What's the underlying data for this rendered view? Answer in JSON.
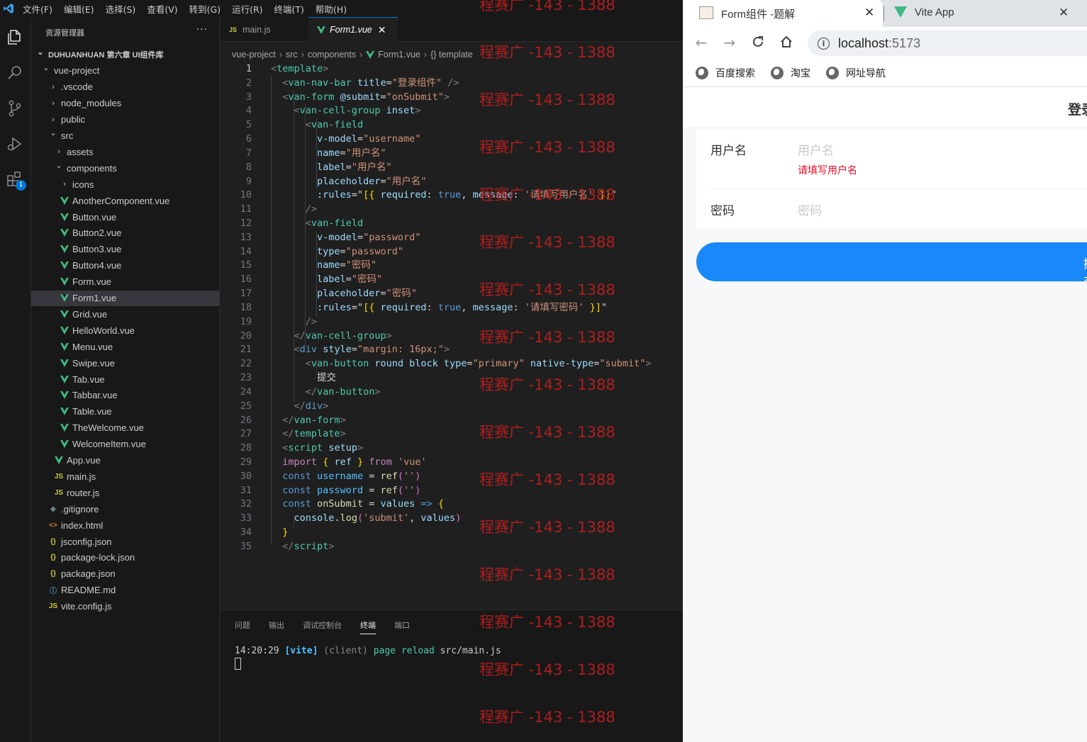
{
  "vscode": {
    "menu": [
      "文件(F)",
      "编辑(E)",
      "选择(S)",
      "查看(V)",
      "转到(G)",
      "运行(R)",
      "终端(T)",
      "帮助(H)"
    ],
    "explorer_title": "资源管理器",
    "explorer_more": "···",
    "extensions_badge": "1",
    "tree": [
      {
        "label": "DUHUANHUAN 第六章 UI组件库",
        "depth": 0,
        "chev": "⌄",
        "icon": "",
        "bold": true
      },
      {
        "label": "vue-project",
        "depth": 1,
        "chev": "⌄",
        "icon": ""
      },
      {
        "label": ".vscode",
        "depth": 2,
        "chev": "›",
        "icon": ""
      },
      {
        "label": "node_modules",
        "depth": 2,
        "chev": "›",
        "icon": ""
      },
      {
        "label": "public",
        "depth": 2,
        "chev": "›",
        "icon": ""
      },
      {
        "label": "src",
        "depth": 2,
        "chev": "⌄",
        "icon": ""
      },
      {
        "label": "assets",
        "depth": 3,
        "chev": "›",
        "icon": ""
      },
      {
        "label": "components",
        "depth": 3,
        "chev": "⌄",
        "icon": ""
      },
      {
        "label": "icons",
        "depth": 4,
        "chev": "›",
        "icon": ""
      },
      {
        "label": "AnotherComponent.vue",
        "depth": 4,
        "chev": "",
        "icon": "vue"
      },
      {
        "label": "Button.vue",
        "depth": 4,
        "chev": "",
        "icon": "vue"
      },
      {
        "label": "Button2.vue",
        "depth": 4,
        "chev": "",
        "icon": "vue"
      },
      {
        "label": "Button3.vue",
        "depth": 4,
        "chev": "",
        "icon": "vue"
      },
      {
        "label": "Button4.vue",
        "depth": 4,
        "chev": "",
        "icon": "vue"
      },
      {
        "label": "Form.vue",
        "depth": 4,
        "chev": "",
        "icon": "vue"
      },
      {
        "label": "Form1.vue",
        "depth": 4,
        "chev": "",
        "icon": "vue",
        "selected": true
      },
      {
        "label": "Grid.vue",
        "depth": 4,
        "chev": "",
        "icon": "vue"
      },
      {
        "label": "HelloWorld.vue",
        "depth": 4,
        "chev": "",
        "icon": "vue"
      },
      {
        "label": "Menu.vue",
        "depth": 4,
        "chev": "",
        "icon": "vue"
      },
      {
        "label": "Swipe.vue",
        "depth": 4,
        "chev": "",
        "icon": "vue"
      },
      {
        "label": "Tab.vue",
        "depth": 4,
        "chev": "",
        "icon": "vue"
      },
      {
        "label": "Tabbar.vue",
        "depth": 4,
        "chev": "",
        "icon": "vue"
      },
      {
        "label": "Table.vue",
        "depth": 4,
        "chev": "",
        "icon": "vue"
      },
      {
        "label": "TheWelcome.vue",
        "depth": 4,
        "chev": "",
        "icon": "vue"
      },
      {
        "label": "WelcomeItem.vue",
        "depth": 4,
        "chev": "",
        "icon": "vue"
      },
      {
        "label": "App.vue",
        "depth": 3,
        "chev": "",
        "icon": "vue"
      },
      {
        "label": "main.js",
        "depth": 3,
        "chev": "",
        "icon": "js"
      },
      {
        "label": "router.js",
        "depth": 3,
        "chev": "",
        "icon": "js"
      },
      {
        "label": ".gitignore",
        "depth": 2,
        "chev": "",
        "icon": "git"
      },
      {
        "label": "index.html",
        "depth": 2,
        "chev": "",
        "icon": "html"
      },
      {
        "label": "jsconfig.json",
        "depth": 2,
        "chev": "",
        "icon": "json"
      },
      {
        "label": "package-lock.json",
        "depth": 2,
        "chev": "",
        "icon": "json"
      },
      {
        "label": "package.json",
        "depth": 2,
        "chev": "",
        "icon": "json"
      },
      {
        "label": "README.md",
        "depth": 2,
        "chev": "",
        "icon": "info"
      },
      {
        "label": "vite.config.js",
        "depth": 2,
        "chev": "",
        "icon": "js"
      }
    ],
    "icon_glyphs": {
      "vue": "",
      "js": "JS",
      "json": "{}",
      "html": "<>",
      "git": "◆",
      "info": "ⓘ"
    },
    "tabs": [
      {
        "label": "main.js",
        "icon": "js",
        "active": false
      },
      {
        "label": "Form1.vue",
        "icon": "vue",
        "active": true,
        "close": "✕"
      }
    ],
    "breadcrumb": [
      "vue-project",
      "src",
      "components",
      "Form1.vue",
      "{} template"
    ],
    "current_line": 1,
    "code": [
      [
        [
          "t-punc",
          "<"
        ],
        [
          "t-tag",
          "template"
        ],
        [
          "t-punc",
          ">"
        ]
      ],
      [
        [
          "",
          "  "
        ],
        [
          "t-punc",
          "<"
        ],
        [
          "t-tag",
          "van-nav-bar"
        ],
        [
          "",
          " "
        ],
        [
          "t-attr",
          "title"
        ],
        [
          "t-txt",
          "="
        ],
        [
          "t-str",
          "\"登录组件\""
        ],
        [
          "",
          " "
        ],
        [
          "t-punc",
          "/>"
        ]
      ],
      [
        [
          "",
          "  "
        ],
        [
          "t-punc",
          "<"
        ],
        [
          "t-tag",
          "van-form"
        ],
        [
          "",
          " "
        ],
        [
          "t-attr",
          "@submit"
        ],
        [
          "t-txt",
          "="
        ],
        [
          "t-str",
          "\"onSubmit\""
        ],
        [
          "t-punc",
          ">"
        ]
      ],
      [
        [
          "",
          "    "
        ],
        [
          "t-punc",
          "<"
        ],
        [
          "t-tag",
          "van-cell-group"
        ],
        [
          "",
          " "
        ],
        [
          "t-attr",
          "inset"
        ],
        [
          "t-punc",
          ">"
        ]
      ],
      [
        [
          "",
          "      "
        ],
        [
          "t-punc",
          "<"
        ],
        [
          "t-tag",
          "van-field"
        ]
      ],
      [
        [
          "",
          "        "
        ],
        [
          "t-attr",
          "v-model"
        ],
        [
          "t-txt",
          "="
        ],
        [
          "t-str",
          "\"username\""
        ]
      ],
      [
        [
          "",
          "        "
        ],
        [
          "t-attr",
          "name"
        ],
        [
          "t-txt",
          "="
        ],
        [
          "t-str",
          "\"用户名\""
        ]
      ],
      [
        [
          "",
          "        "
        ],
        [
          "t-attr",
          "label"
        ],
        [
          "t-txt",
          "="
        ],
        [
          "t-str",
          "\"用户名\""
        ]
      ],
      [
        [
          "",
          "        "
        ],
        [
          "t-attr",
          "placeholder"
        ],
        [
          "t-txt",
          "="
        ],
        [
          "t-str",
          "\"用户名\""
        ]
      ],
      [
        [
          "",
          "        "
        ],
        [
          "t-attr",
          ":rules"
        ],
        [
          "t-txt",
          "=\""
        ],
        [
          "t-brk",
          "[{"
        ],
        [
          "",
          " "
        ],
        [
          "t-attr",
          "required"
        ],
        [
          "t-txt",
          ":"
        ],
        [
          "",
          " "
        ],
        [
          "t-kw",
          "true"
        ],
        [
          "t-txt",
          ","
        ],
        [
          "",
          " "
        ],
        [
          "t-attr",
          "message"
        ],
        [
          "t-txt",
          ":"
        ],
        [
          "",
          " "
        ],
        [
          "t-str",
          "'请填写用户名'"
        ],
        [
          "",
          " "
        ],
        [
          "t-brk",
          "}]"
        ],
        [
          "t-txt",
          "\""
        ]
      ],
      [
        [
          "",
          "      "
        ],
        [
          "t-punc",
          "/>"
        ]
      ],
      [
        [
          "",
          "      "
        ],
        [
          "t-punc",
          "<"
        ],
        [
          "t-tag",
          "van-field"
        ]
      ],
      [
        [
          "",
          "        "
        ],
        [
          "t-attr",
          "v-model"
        ],
        [
          "t-txt",
          "="
        ],
        [
          "t-str",
          "\"password\""
        ]
      ],
      [
        [
          "",
          "        "
        ],
        [
          "t-attr",
          "type"
        ],
        [
          "t-txt",
          "="
        ],
        [
          "t-str",
          "\"password\""
        ]
      ],
      [
        [
          "",
          "        "
        ],
        [
          "t-attr",
          "name"
        ],
        [
          "t-txt",
          "="
        ],
        [
          "t-str",
          "\"密码\""
        ]
      ],
      [
        [
          "",
          "        "
        ],
        [
          "t-attr",
          "label"
        ],
        [
          "t-txt",
          "="
        ],
        [
          "t-str",
          "\"密码\""
        ]
      ],
      [
        [
          "",
          "        "
        ],
        [
          "t-attr",
          "placeholder"
        ],
        [
          "t-txt",
          "="
        ],
        [
          "t-str",
          "\"密码\""
        ]
      ],
      [
        [
          "",
          "        "
        ],
        [
          "t-attr",
          ":rules"
        ],
        [
          "t-txt",
          "=\""
        ],
        [
          "t-brk",
          "[{"
        ],
        [
          "",
          " "
        ],
        [
          "t-attr",
          "required"
        ],
        [
          "t-txt",
          ":"
        ],
        [
          "",
          " "
        ],
        [
          "t-kw",
          "true"
        ],
        [
          "t-txt",
          ","
        ],
        [
          "",
          " "
        ],
        [
          "t-attr",
          "message"
        ],
        [
          "t-txt",
          ":"
        ],
        [
          "",
          " "
        ],
        [
          "t-str",
          "'请填写密码'"
        ],
        [
          "",
          " "
        ],
        [
          "t-brk",
          "}]"
        ],
        [
          "t-txt",
          "\""
        ]
      ],
      [
        [
          "",
          "      "
        ],
        [
          "t-punc",
          "/>"
        ]
      ],
      [
        [
          "",
          "    "
        ],
        [
          "t-punc",
          "</"
        ],
        [
          "t-tag",
          "van-cell-group"
        ],
        [
          "t-punc",
          ">"
        ]
      ],
      [
        [
          "",
          "    "
        ],
        [
          "t-punc",
          "<"
        ],
        [
          "t-kw",
          "div"
        ],
        [
          "",
          " "
        ],
        [
          "t-attr",
          "style"
        ],
        [
          "t-txt",
          "="
        ],
        [
          "t-str",
          "\"margin: 16px;\""
        ],
        [
          "t-punc",
          ">"
        ]
      ],
      [
        [
          "",
          "      "
        ],
        [
          "t-punc",
          "<"
        ],
        [
          "t-tag",
          "van-button"
        ],
        [
          "",
          " "
        ],
        [
          "t-attr",
          "round"
        ],
        [
          "",
          " "
        ],
        [
          "t-attr",
          "block"
        ],
        [
          "",
          " "
        ],
        [
          "t-attr",
          "type"
        ],
        [
          "t-txt",
          "="
        ],
        [
          "t-str",
          "\"primary\""
        ],
        [
          "",
          " "
        ],
        [
          "t-attr",
          "native-type"
        ],
        [
          "t-txt",
          "="
        ],
        [
          "t-str",
          "\"submit\""
        ],
        [
          "t-punc",
          ">"
        ]
      ],
      [
        [
          "",
          "        "
        ],
        [
          "t-txt",
          "提交"
        ]
      ],
      [
        [
          "",
          "      "
        ],
        [
          "t-punc",
          "</"
        ],
        [
          "t-tag",
          "van-button"
        ],
        [
          "t-punc",
          ">"
        ]
      ],
      [
        [
          "",
          "    "
        ],
        [
          "t-punc",
          "</"
        ],
        [
          "t-kw",
          "div"
        ],
        [
          "t-punc",
          ">"
        ]
      ],
      [
        [
          "",
          "  "
        ],
        [
          "t-punc",
          "</"
        ],
        [
          "t-tag",
          "van-form"
        ],
        [
          "t-punc",
          ">"
        ]
      ],
      [
        [
          "",
          "  "
        ],
        [
          "t-punc",
          "</"
        ],
        [
          "t-tag",
          "template"
        ],
        [
          "t-punc",
          ">"
        ]
      ],
      [
        [
          "",
          "  "
        ],
        [
          "t-punc",
          "<"
        ],
        [
          "t-tag",
          "script"
        ],
        [
          "",
          " "
        ],
        [
          "t-attr",
          "setup"
        ],
        [
          "t-punc",
          ">"
        ]
      ],
      [
        [
          "",
          "  "
        ],
        [
          "t-kw2",
          "import"
        ],
        [
          "",
          " "
        ],
        [
          "t-brk",
          "{"
        ],
        [
          "",
          " "
        ],
        [
          "t-attr",
          "ref"
        ],
        [
          "",
          " "
        ],
        [
          "t-brk",
          "}"
        ],
        [
          "",
          " "
        ],
        [
          "t-kw2",
          "from"
        ],
        [
          "",
          " "
        ],
        [
          "t-str",
          "'vue'"
        ]
      ],
      [
        [
          "",
          "  "
        ],
        [
          "t-kw",
          "const"
        ],
        [
          "",
          " "
        ],
        [
          "t-var",
          "username"
        ],
        [
          "",
          " "
        ],
        [
          "t-txt",
          "="
        ],
        [
          "",
          " "
        ],
        [
          "t-fn",
          "ref"
        ],
        [
          "t-brk2",
          "("
        ],
        [
          "t-str",
          "''"
        ],
        [
          "t-brk2",
          ")"
        ]
      ],
      [
        [
          "",
          "  "
        ],
        [
          "t-kw",
          "const"
        ],
        [
          "",
          " "
        ],
        [
          "t-var",
          "password"
        ],
        [
          "",
          " "
        ],
        [
          "t-txt",
          "="
        ],
        [
          "",
          " "
        ],
        [
          "t-fn",
          "ref"
        ],
        [
          "t-brk2",
          "("
        ],
        [
          "t-str",
          "''"
        ],
        [
          "t-brk2",
          ")"
        ]
      ],
      [
        [
          "",
          "  "
        ],
        [
          "t-kw",
          "const"
        ],
        [
          "",
          " "
        ],
        [
          "t-fn",
          "onSubmit"
        ],
        [
          "",
          " "
        ],
        [
          "t-txt",
          "="
        ],
        [
          "",
          " "
        ],
        [
          "t-attr",
          "values"
        ],
        [
          "",
          " "
        ],
        [
          "t-kw",
          "=>"
        ],
        [
          "",
          " "
        ],
        [
          "t-brk",
          "{"
        ]
      ],
      [
        [
          "",
          "    "
        ],
        [
          "t-attr",
          "console"
        ],
        [
          "t-txt",
          "."
        ],
        [
          "t-fn",
          "log"
        ],
        [
          "t-brk2",
          "("
        ],
        [
          "t-str",
          "'submit'"
        ],
        [
          "t-txt",
          ","
        ],
        [
          "",
          " "
        ],
        [
          "t-attr",
          "values"
        ],
        [
          "t-brk2",
          ")"
        ]
      ],
      [
        [
          "",
          "  "
        ],
        [
          "t-brk",
          "}"
        ]
      ],
      [
        [
          "",
          "  "
        ],
        [
          "t-punc",
          "</"
        ],
        [
          "t-tag",
          "script"
        ],
        [
          "t-punc",
          ">"
        ]
      ]
    ],
    "panel_tabs": [
      {
        "label": "问题",
        "active": false
      },
      {
        "label": "输出",
        "active": false
      },
      {
        "label": "调试控制台",
        "active": false
      },
      {
        "label": "终端",
        "active": true
      },
      {
        "label": "端口",
        "active": false
      }
    ],
    "terminal": {
      "time": "14:20:29",
      "tag": "[vite]",
      "client": "(client)",
      "msg": "page reload",
      "file": "src/main.js"
    },
    "watermark": "程赛广 -143 - 1388",
    "colors": {
      "accent": "#0078d4",
      "vue_green": "#41b883"
    }
  },
  "browser": {
    "tabs": [
      {
        "label": "Form组件 -题解",
        "close": "✕"
      },
      {
        "label": "Vite App",
        "close": "✕"
      }
    ],
    "url": {
      "host": "localhost",
      "port": ":5173"
    },
    "bookmarks": [
      "百度搜索",
      "淘宝",
      "网址导航"
    ],
    "page": {
      "nav_title": "登录组件",
      "fields": [
        {
          "label": "用户名",
          "placeholder": "用户名",
          "error": "请填写用户名"
        },
        {
          "label": "密码",
          "placeholder": "密码",
          "error": ""
        }
      ],
      "submit_label": "提交"
    },
    "colors": {
      "primary": "#1989fa",
      "danger": "#ee0a24"
    }
  }
}
